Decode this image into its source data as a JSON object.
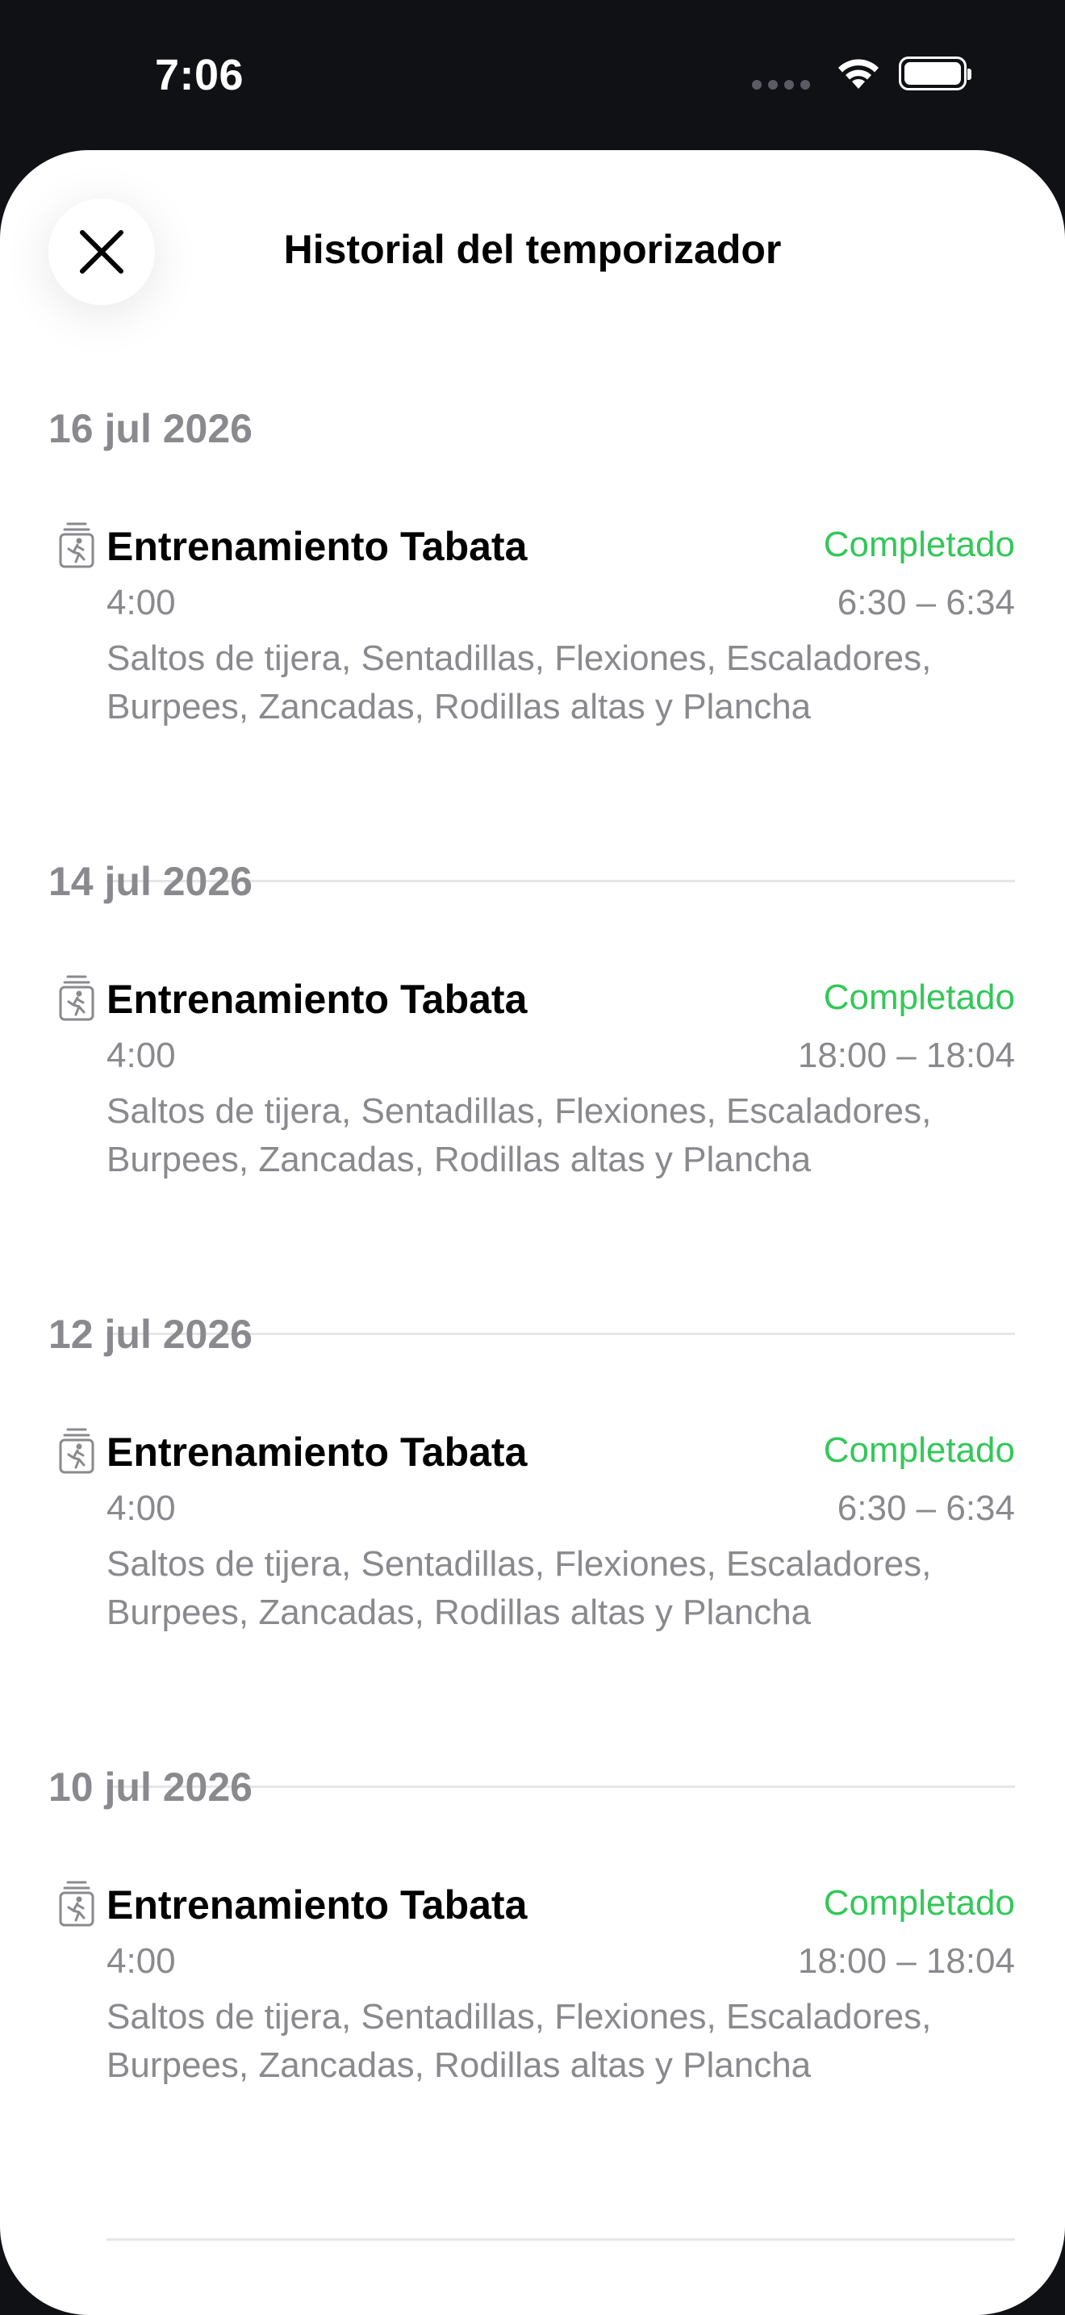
{
  "status_bar": {
    "time": "7:06"
  },
  "header": {
    "title": "Historial del temporizador",
    "close_icon": "close-icon"
  },
  "colors": {
    "status_completed": "#34C759",
    "secondary_text": "#8A8A8E"
  },
  "sections": [
    {
      "date": "16 jul 2026",
      "entry": {
        "icon": "timer-workout-icon",
        "title": "Entrenamiento Tabata",
        "status": "Completado",
        "duration": "4:00",
        "time_range": "6:30 – 6:34",
        "exercises": "Saltos de tijera, Sentadillas, Flexiones, Escaladores, Burpees, Zancadas, Rodillas altas y Plancha"
      }
    },
    {
      "date": "14 jul 2026",
      "entry": {
        "icon": "timer-workout-icon",
        "title": "Entrenamiento Tabata",
        "status": "Completado",
        "duration": "4:00",
        "time_range": "18:00 – 18:04",
        "exercises": "Saltos de tijera, Sentadillas, Flexiones, Escaladores, Burpees, Zancadas, Rodillas altas y Plancha"
      }
    },
    {
      "date": "12 jul 2026",
      "entry": {
        "icon": "timer-workout-icon",
        "title": "Entrenamiento Tabata",
        "status": "Completado",
        "duration": "4:00",
        "time_range": "6:30 – 6:34",
        "exercises": "Saltos de tijera, Sentadillas, Flexiones, Escaladores, Burpees, Zancadas, Rodillas altas y Plancha"
      }
    },
    {
      "date": "10 jul 2026",
      "entry": {
        "icon": "timer-workout-icon",
        "title": "Entrenamiento Tabata",
        "status": "Completado",
        "duration": "4:00",
        "time_range": "18:00 – 18:04",
        "exercises": "Saltos de tijera, Sentadillas, Flexiones, Escaladores, Burpees, Zancadas, Rodillas altas y Plancha"
      }
    }
  ]
}
